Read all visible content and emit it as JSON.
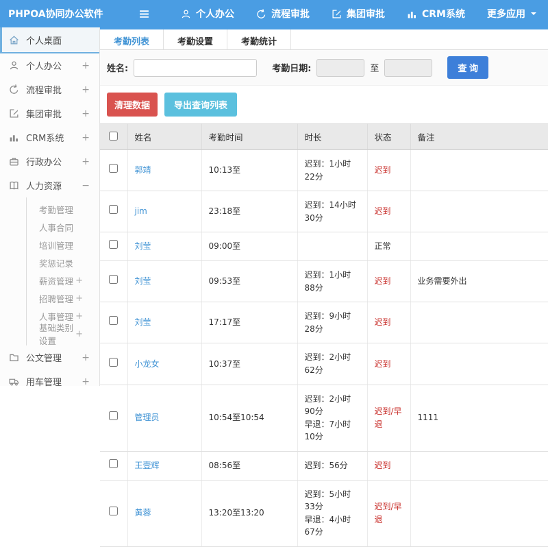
{
  "topbar": {
    "brand": "PHPOA协同办公软件",
    "nav": [
      {
        "label": "个人办公",
        "icon": "user-icon"
      },
      {
        "label": "流程审批",
        "icon": "process-icon"
      },
      {
        "label": "集团审批",
        "icon": "edit-icon"
      },
      {
        "label": "CRM系统",
        "icon": "chart-icon"
      },
      {
        "label": "更多应用",
        "icon": "caret-down-icon"
      }
    ]
  },
  "sidebar": {
    "items": [
      {
        "label": "个人桌面",
        "icon": "home-icon",
        "active": true
      },
      {
        "label": "个人办公",
        "icon": "user-icon",
        "expand": "+"
      },
      {
        "label": "流程审批",
        "icon": "process-icon",
        "expand": "+"
      },
      {
        "label": "集团审批",
        "icon": "edit-icon",
        "expand": "+"
      },
      {
        "label": "CRM系统",
        "icon": "chart-icon",
        "expand": "+"
      },
      {
        "label": "行政办公",
        "icon": "briefcase-icon",
        "expand": "+"
      },
      {
        "label": "人力资源",
        "icon": "book-icon",
        "expand": "−"
      }
    ],
    "hr_submenu": [
      {
        "label": "考勤管理",
        "expand": ""
      },
      {
        "label": "人事合同",
        "expand": ""
      },
      {
        "label": "培训管理",
        "expand": ""
      },
      {
        "label": "奖惩记录",
        "expand": ""
      },
      {
        "label": "薪资管理",
        "expand": "+"
      },
      {
        "label": "招聘管理",
        "expand": "+"
      },
      {
        "label": "人事管理",
        "expand": "+"
      },
      {
        "label": "基础类别设置",
        "expand": "+"
      }
    ],
    "items_bottom": [
      {
        "label": "公文管理",
        "icon": "folder-icon",
        "expand": "+"
      },
      {
        "label": "用车管理",
        "icon": "truck-icon",
        "expand": "+"
      }
    ]
  },
  "tabs": [
    {
      "label": "考勤列表",
      "active": true
    },
    {
      "label": "考勤设置",
      "active": false
    },
    {
      "label": "考勤统计",
      "active": false
    }
  ],
  "search": {
    "name_label": "姓名:",
    "name_value": "",
    "date_label": "考勤日期:",
    "date_from_value": "",
    "to_label": "至",
    "date_to_value": "",
    "query_button": "查 询"
  },
  "actions": {
    "clean_button": "清理数据",
    "export_button": "导出查询列表"
  },
  "table": {
    "headers": [
      "姓名",
      "考勤时间",
      "时长",
      "状态",
      "备注"
    ],
    "rows": [
      {
        "name": "郭靖",
        "time": "10:13至",
        "duration1": "迟到：1小时22分",
        "duration2": "",
        "status": "迟到",
        "status_class": "late",
        "note": ""
      },
      {
        "name": "jim",
        "time": "23:18至",
        "duration1": "迟到：14小时30分",
        "duration2": "",
        "status": "迟到",
        "status_class": "late",
        "note": ""
      },
      {
        "name": "刘莹",
        "time": "09:00至",
        "duration1": "",
        "duration2": "",
        "status": "正常",
        "status_class": "normal",
        "note": ""
      },
      {
        "name": "刘莹",
        "time": "09:53至",
        "duration1": "迟到：1小时88分",
        "duration2": "",
        "status": "迟到",
        "status_class": "late",
        "note": "业务需要外出"
      },
      {
        "name": "刘莹",
        "time": "17:17至",
        "duration1": "迟到：9小时28分",
        "duration2": "",
        "status": "迟到",
        "status_class": "late",
        "note": ""
      },
      {
        "name": "小龙女",
        "time": "10:37至",
        "duration1": "迟到：2小时62分",
        "duration2": "",
        "status": "迟到",
        "status_class": "late",
        "note": ""
      },
      {
        "name": "管理员",
        "time": "10:54至10:54",
        "duration1": "迟到：2小时90分",
        "duration2": "早退：7小时10分",
        "status": "迟到/早退",
        "status_class": "late",
        "note": "1111"
      },
      {
        "name": "王壹辉",
        "time": "08:56至",
        "duration1": "迟到：56分",
        "duration2": "",
        "status": "迟到",
        "status_class": "late",
        "note": ""
      },
      {
        "name": "黄蓉",
        "time": "13:20至13:20",
        "duration1": "迟到：5小时33分",
        "duration2": "早退：4小时67分",
        "status": "迟到/早退",
        "status_class": "late",
        "note": ""
      }
    ]
  },
  "colors": {
    "topbar_blue": "#4a9de3",
    "accent_blue": "#4294d5",
    "status_red": "#c9302c",
    "danger_red": "#d9534f",
    "info_blue": "#5bc0de",
    "primary_blue": "#3d7fd9"
  }
}
